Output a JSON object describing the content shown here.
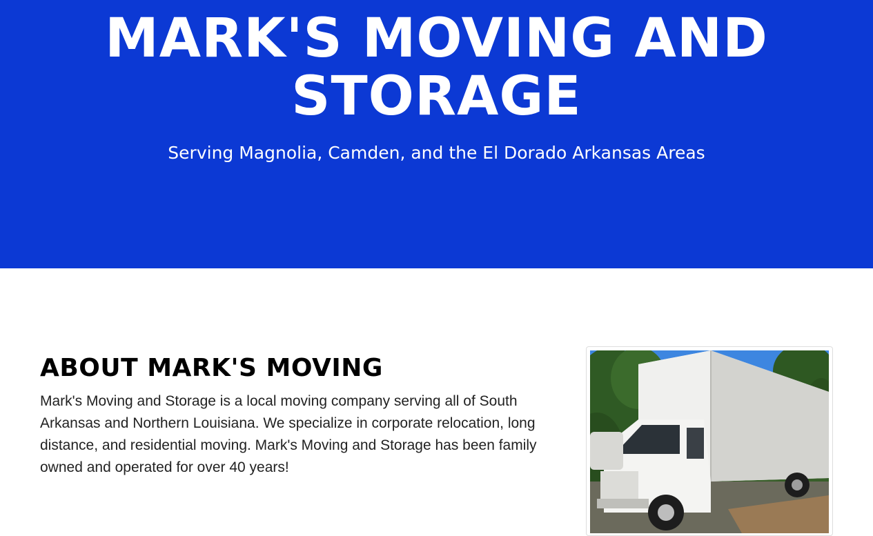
{
  "hero": {
    "title_line1": "MARK'S MOVING AND",
    "title_line2": "STORAGE",
    "subtitle": "Serving Magnolia, Camden, and the El Dorado Arkansas Areas",
    "background_color": "#0c39d4"
  },
  "about": {
    "heading": "ABOUT MARK'S MOVING",
    "body": "Mark's Moving and Storage is a local moving company serving all of South Arkansas and Northern Louisiana. We specialize in corporate relocation, long distance, and residential moving. Mark's Moving and Storage has been family owned and operated for over 40 years!"
  },
  "photo": {
    "subject": "white moving box truck parked on driveway with trees"
  }
}
